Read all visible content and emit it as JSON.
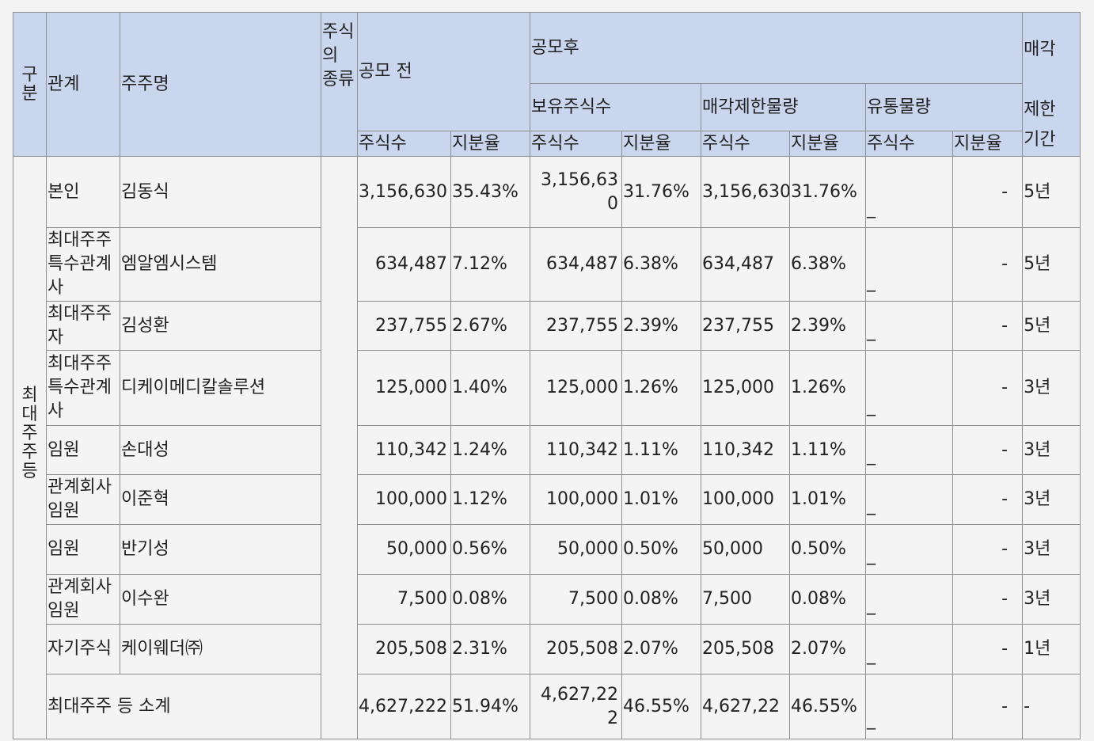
{
  "header": {
    "gubun": "구분",
    "relation": "관계",
    "holder_name": "주주명",
    "stock_type": "주식의 종류",
    "before_ipo": "공모 전",
    "after_ipo": "공모후",
    "lock_period_1": "매각",
    "lock_period_2": "제한",
    "lock_period_3": "기간",
    "holding_shares": "보유주식수",
    "restricted": "매각제한물량",
    "float": "유통물량",
    "shares": "주식수",
    "ratio": "지분율"
  },
  "group_label": "최대주주등",
  "rows": [
    {
      "relation": "본인",
      "name": "김동식",
      "pre_shares": "3,156,630",
      "pre_ratio": "35.43%",
      "post_shares": "3,156,630",
      "post_ratio": "31.76%",
      "res_shares": "3,156,630",
      "res_ratio": "31.76%",
      "float_shares": "_",
      "float_ratio": "-",
      "period": "5년"
    },
    {
      "relation": "최대주주특수관계사",
      "name": "엠알엠시스템",
      "pre_shares": "634,487",
      "pre_ratio": "7.12%",
      "post_shares": "634,487",
      "post_ratio": "6.38%",
      "res_shares": "634,487",
      "res_ratio": "6.38%",
      "float_shares": "_",
      "float_ratio": "-",
      "period": "5년"
    },
    {
      "relation": "최대주주자",
      "name": "김성환",
      "pre_shares": "237,755",
      "pre_ratio": "2.67%",
      "post_shares": "237,755",
      "post_ratio": "2.39%",
      "res_shares": "237,755",
      "res_ratio": "2.39%",
      "float_shares": "_",
      "float_ratio": "-",
      "period": "5년"
    },
    {
      "relation": "최대주주특수관계사",
      "name": "디케이메디칼솔루션",
      "pre_shares": "125,000",
      "pre_ratio": "1.40%",
      "post_shares": "125,000",
      "post_ratio": "1.26%",
      "res_shares": "125,000",
      "res_ratio": "1.26%",
      "float_shares": "_",
      "float_ratio": "-",
      "period": "3년"
    },
    {
      "relation": "임원",
      "name": "손대성",
      "pre_shares": "110,342",
      "pre_ratio": "1.24%",
      "post_shares": "110,342",
      "post_ratio": "1.11%",
      "res_shares": "110,342",
      "res_ratio": "1.11%",
      "float_shares": "_",
      "float_ratio": "-",
      "period": "3년"
    },
    {
      "relation": "관계회사임원",
      "name": "이준혁",
      "pre_shares": "100,000",
      "pre_ratio": "1.12%",
      "post_shares": "100,000",
      "post_ratio": "1.01%",
      "res_shares": "100,000",
      "res_ratio": "1.01%",
      "float_shares": "_",
      "float_ratio": "-",
      "period": "3년"
    },
    {
      "relation": "임원",
      "name": "반기성",
      "pre_shares": "50,000",
      "pre_ratio": "0.56%",
      "post_shares": "50,000",
      "post_ratio": "0.50%",
      "res_shares": "50,000",
      "res_ratio": "0.50%",
      "float_shares": "_",
      "float_ratio": "-",
      "period": "3년"
    },
    {
      "relation": "관계회사임원",
      "name": "이수완",
      "pre_shares": "7,500",
      "pre_ratio": "0.08%",
      "post_shares": "7,500",
      "post_ratio": "0.08%",
      "res_shares": "7,500",
      "res_ratio": "0.08%",
      "float_shares": "_",
      "float_ratio": "-",
      "period": "3년"
    },
    {
      "relation": "자기주식",
      "name": "케이웨더㈜",
      "pre_shares": "205,508",
      "pre_ratio": "2.31%",
      "post_shares": "205,508",
      "post_ratio": "2.07%",
      "res_shares": "205,508",
      "res_ratio": "2.07%",
      "float_shares": "_",
      "float_ratio": "-",
      "period": "1년"
    }
  ],
  "subtotal": {
    "label": "최대주주 등 소계",
    "pre_shares": "4,627,222",
    "pre_ratio": "51.94%",
    "post_shares": "4,627,222",
    "post_ratio": "46.55%",
    "res_shares": "4,627,22",
    "res_ratio": "46.55%",
    "float_shares": "_",
    "float_ratio": "-",
    "period": "-"
  }
}
